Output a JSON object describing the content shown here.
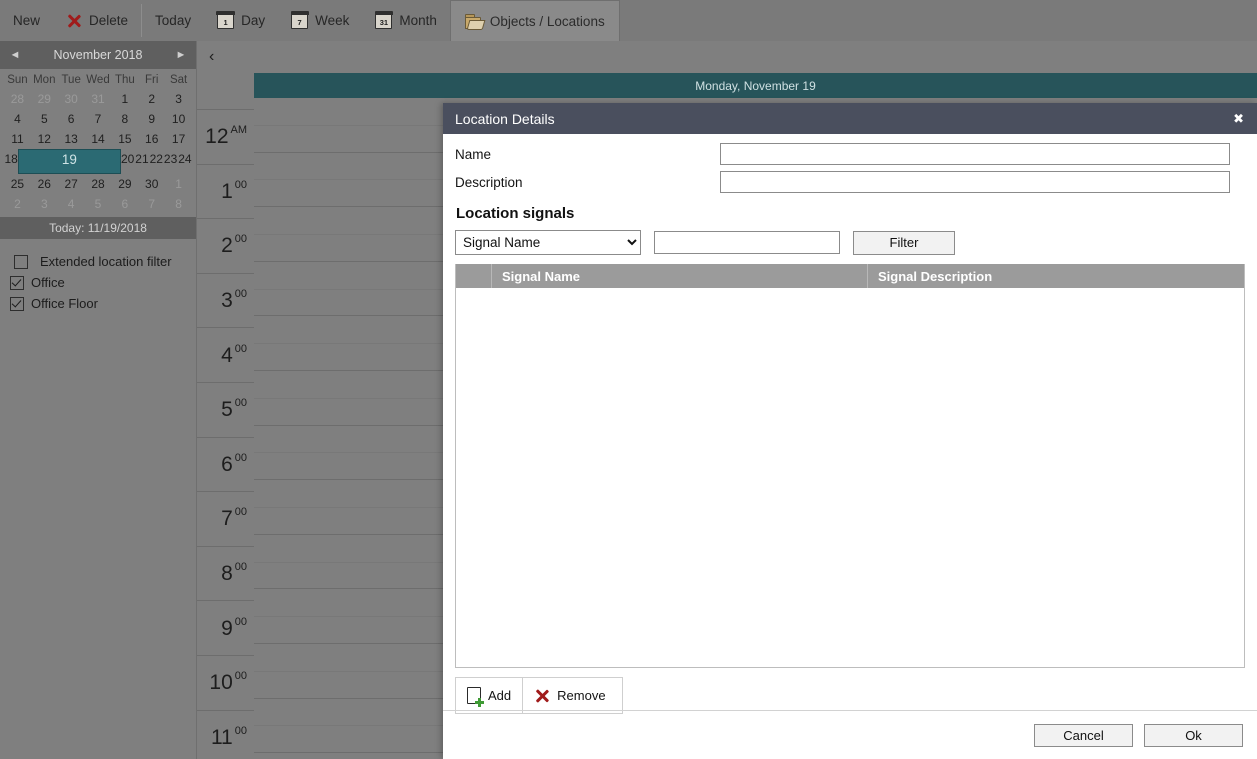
{
  "toolbar": {
    "new": "New",
    "delete": "Delete",
    "today": "Today",
    "day": "Day",
    "day_icon_num": "1",
    "week": "Week",
    "week_icon_num": "7",
    "month": "Month",
    "month_icon_num": "31",
    "objects_locations": "Objects / Locations"
  },
  "sidebar": {
    "calendar": {
      "prev_arrow": "◄",
      "next_arrow": "►",
      "title": "November 2018",
      "dow": [
        "Sun",
        "Mon",
        "Tue",
        "Wed",
        "Thu",
        "Fri",
        "Sat"
      ],
      "weeks": [
        [
          {
            "d": "28",
            "m": true
          },
          {
            "d": "29",
            "m": true
          },
          {
            "d": "30",
            "m": true
          },
          {
            "d": "31",
            "m": true
          },
          {
            "d": "1"
          },
          {
            "d": "2"
          },
          {
            "d": "3"
          }
        ],
        [
          {
            "d": "4"
          },
          {
            "d": "5"
          },
          {
            "d": "6"
          },
          {
            "d": "7"
          },
          {
            "d": "8"
          },
          {
            "d": "9"
          },
          {
            "d": "10"
          }
        ],
        [
          {
            "d": "11"
          },
          {
            "d": "12"
          },
          {
            "d": "13"
          },
          {
            "d": "14"
          },
          {
            "d": "15"
          },
          {
            "d": "16"
          },
          {
            "d": "17"
          }
        ],
        [
          {
            "d": "18"
          },
          {
            "d": "19",
            "sel": true
          },
          {
            "d": "20"
          },
          {
            "d": "21"
          },
          {
            "d": "22"
          },
          {
            "d": "23"
          },
          {
            "d": "24"
          }
        ],
        [
          {
            "d": "25"
          },
          {
            "d": "26"
          },
          {
            "d": "27"
          },
          {
            "d": "28"
          },
          {
            "d": "29"
          },
          {
            "d": "30"
          },
          {
            "d": "1",
            "m": true
          }
        ],
        [
          {
            "d": "2",
            "m": true
          },
          {
            "d": "3",
            "m": true
          },
          {
            "d": "4",
            "m": true
          },
          {
            "d": "5",
            "m": true
          },
          {
            "d": "6",
            "m": true
          },
          {
            "d": "7",
            "m": true
          },
          {
            "d": "8",
            "m": true
          }
        ]
      ],
      "today_label": "Today: 11/19/2018",
      "selected_color": "#2b6a73"
    },
    "filters": [
      {
        "label": "Extended location filter",
        "checked": false,
        "indent": true
      },
      {
        "label": "Office",
        "checked": true,
        "indent": false
      },
      {
        "label": "Office Floor",
        "checked": true,
        "indent": false
      }
    ]
  },
  "calendar_view": {
    "back_chevron": "‹",
    "day_header": "Monday, November 19",
    "header_color": "#27545a",
    "hours": [
      {
        "h": "12",
        "m": "AM"
      },
      {
        "h": "1",
        "m": "00"
      },
      {
        "h": "2",
        "m": "00"
      },
      {
        "h": "3",
        "m": "00"
      },
      {
        "h": "4",
        "m": "00"
      },
      {
        "h": "5",
        "m": "00"
      },
      {
        "h": "6",
        "m": "00"
      },
      {
        "h": "7",
        "m": "00"
      },
      {
        "h": "8",
        "m": "00"
      },
      {
        "h": "9",
        "m": "00"
      },
      {
        "h": "10",
        "m": "00"
      },
      {
        "h": "11",
        "m": "00"
      }
    ]
  },
  "dialog": {
    "title": "Location Details",
    "close_glyph": "✖",
    "title_color": "#4a4f5e",
    "name_label": "Name",
    "name_value": "",
    "description_label": "Description",
    "description_value": "",
    "section_title": "Location signals",
    "filter_select_value": "Signal Name",
    "filter_select_options": [
      "Signal Name"
    ],
    "filter_text_value": "",
    "filter_button": "Filter",
    "table": {
      "columns": [
        "",
        "Signal Name",
        "Signal Description"
      ],
      "rows": []
    },
    "add_label": "Add",
    "remove_label": "Remove",
    "cancel_label": "Cancel",
    "ok_label": "Ok"
  }
}
